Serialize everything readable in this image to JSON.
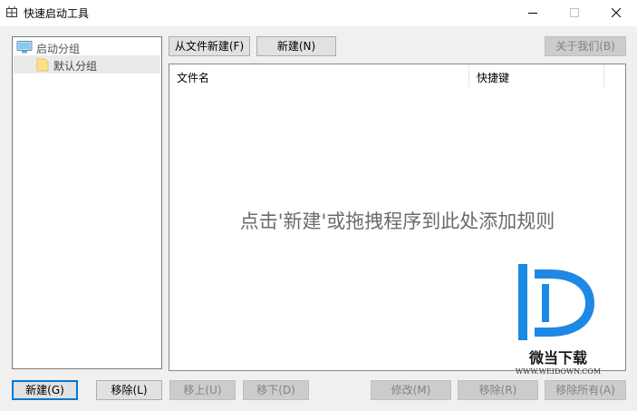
{
  "window": {
    "title": "快速启动工具",
    "app_icon": "grid-app-icon",
    "controls": [
      "minimize-icon",
      "maximize-icon",
      "close-icon"
    ]
  },
  "tree": {
    "root_label": "启动分组",
    "root_icon": "monitor-icon",
    "children": [
      {
        "label": "默认分组",
        "icon": "folder-icon",
        "selected": true
      }
    ]
  },
  "toolbar": {
    "from_file_label": "从文件新建(F)",
    "new_label": "新建(N)",
    "about_label": "关于我们(B)"
  },
  "list": {
    "columns": [
      "文件名",
      "快捷键"
    ],
    "rows": [],
    "empty_hint": "点击'新建'或拖拽程序到此处添加规则"
  },
  "bottom_buttons": {
    "new_label": "新建(G)",
    "remove_group_label": "移除(L)",
    "move_up_label": "移上(U)",
    "move_down_label": "移下(D)",
    "modify_label": "修改(M)",
    "remove_label": "移除(R)",
    "remove_all_label": "移除所有(A)"
  },
  "watermark": {
    "title": "微当下载",
    "url": "WWW.WEIDOWN.COM"
  },
  "colors": {
    "accent": "#0078d7",
    "watermark_blue": "#1e88e5",
    "disabled_text": "#838383",
    "button_face": "#e1e1e1"
  }
}
